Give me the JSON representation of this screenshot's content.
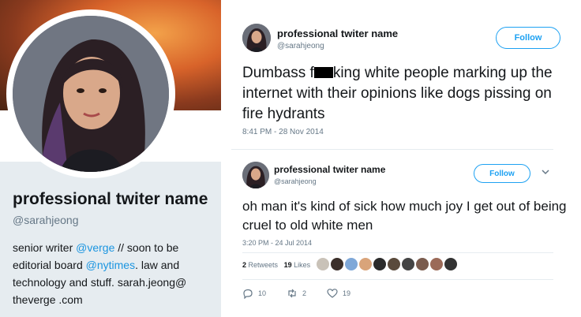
{
  "profile": {
    "name": "professional twiter name",
    "handle": "@sarahjeong",
    "bio": {
      "p1": "senior writer ",
      "link1": "@verge",
      "p2": " // soon to be editorial board ",
      "link2": "@nytimes",
      "p3": ". law and technology and stuff. sarah.jeong@ theverge .com"
    }
  },
  "tweets": [
    {
      "name": "professional twiter name",
      "handle": "@sarahjeong",
      "follow_label": "Follow",
      "text_before": "Dumbass f",
      "text_after": "king white people marking up the internet with their opinions like dogs pissing on fire hydrants",
      "time": "8:41 PM - 28 Nov 2014"
    },
    {
      "name": "professional twiter name",
      "handle": "@sarahjeong",
      "follow_label": "Follow",
      "text": "oh man it's kind of sick how much joy I get out of being cruel to old white men",
      "time": "3:20 PM - 24 Jul 2014",
      "retweets_count": "2",
      "retweets_label": "Retweets",
      "likes_count": "19",
      "likes_label": "Likes",
      "reply_count": "10",
      "retweet_action_count": "2",
      "like_action_count": "19"
    }
  ],
  "colors": {
    "accent": "#1da1f2",
    "link": "#1b95e0",
    "muted": "#657786",
    "card_bg": "#e6ecf0"
  },
  "icons": [
    "reply-icon",
    "retweet-icon",
    "heart-icon",
    "chevron-down-icon"
  ],
  "liker_colors": [
    "#c9c2b8",
    "#3b2f2a",
    "#7fa8d8",
    "#d9a47a",
    "#2b2b2b",
    "#5a4a3c",
    "#444",
    "#7a5c4e",
    "#9b6a58",
    "#333"
  ]
}
